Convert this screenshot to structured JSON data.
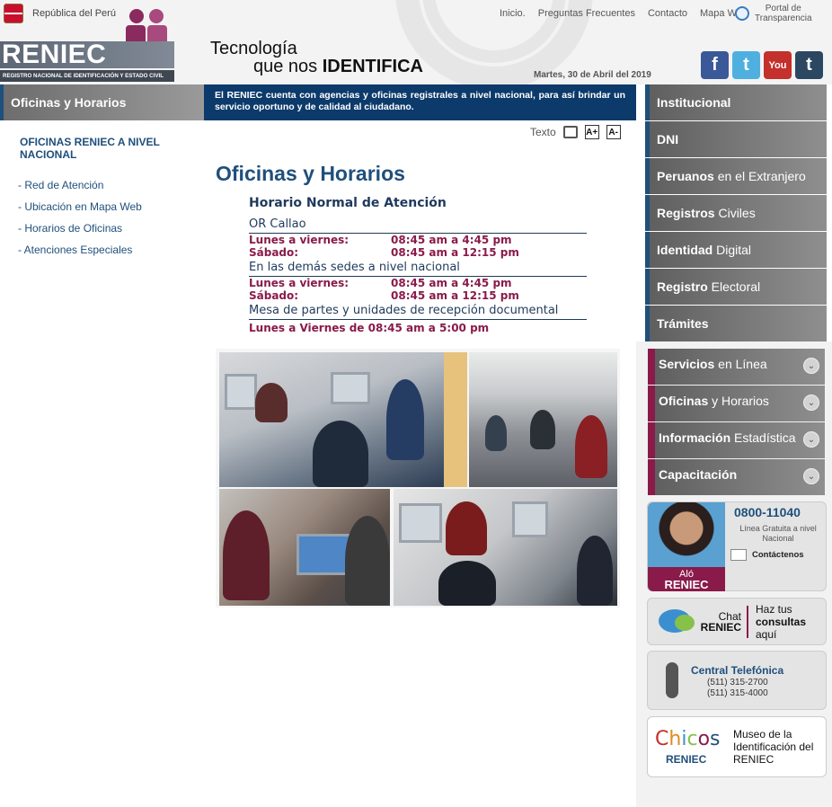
{
  "header": {
    "gov_label": "República del Perú",
    "logo_word": "RENIEC",
    "logo_sub": "REGISTRO NACIONAL DE IDENTIFICACIÓN Y ESTADO CIVIL",
    "slogan_l1": "Tecnología",
    "slogan_l2a": "que nos",
    "slogan_l2b": "IDENTIFICA",
    "topnav": [
      "Inicio.",
      "Preguntas Frecuentes",
      "Contacto",
      "Mapa Web"
    ],
    "transparency_l1": "Portal de",
    "transparency_l2": "Transparencia",
    "date": "Martes, 30 de Abril del 2019",
    "social": [
      {
        "name": "facebook-icon",
        "glyph": "f",
        "color": "#3b5998"
      },
      {
        "name": "twitter-icon",
        "glyph": "t",
        "color": "#4fb0e0"
      },
      {
        "name": "youtube-icon",
        "glyph": "You",
        "color": "#c4302b"
      },
      {
        "name": "tumblr-icon",
        "glyph": "t",
        "color": "#2c4762"
      }
    ]
  },
  "left": {
    "title": "Oficinas y Horarios",
    "section": "OFICINAS RENIEC A NIVEL NACIONAL",
    "links": [
      "- Red de Atención",
      "- Ubicación en Mapa Web",
      "- Horarios de Oficinas",
      "- Atenciones Especiales"
    ]
  },
  "main": {
    "notice": "El RENIEC cuenta con agencias y oficinas registrales a nivel nacional, para así brindar un servicio oportuno y de calidad al ciudadano.",
    "text_label": "Texto",
    "font_up": "A+",
    "font_down": "A-",
    "title": "Oficinas y Horarios",
    "hours": {
      "heading": "Horario Normal de Atención",
      "loc1": "OR Callao",
      "loc1_rows": [
        {
          "day": "Lunes a viernes:",
          "time": "08:45 am a 4:45 pm"
        },
        {
          "day": "Sábado:",
          "time": "08:45 am a 12:15 pm"
        }
      ],
      "loc2": "En las demás sedes a nivel nacional",
      "loc2_rows": [
        {
          "day": "Lunes a viernes:",
          "time": "08:45 am a 4:45 pm"
        },
        {
          "day": "Sábado:",
          "time": "08:45 am a 12:15 pm"
        }
      ],
      "loc3": "Mesa de partes y unidades de recepción documental",
      "loc3_note": "Lunes a Viernes de 08:45 am a 5:00 pm"
    }
  },
  "right": {
    "nav": [
      {
        "bold": "Institucional",
        "rest": ""
      },
      {
        "bold": "DNI",
        "rest": ""
      },
      {
        "bold": "Peruanos",
        "rest": " en el Extranjero"
      },
      {
        "bold": "Registros",
        "rest": " Civiles"
      },
      {
        "bold": "Identidad",
        "rest": " Digital"
      },
      {
        "bold": "Registro",
        "rest": " Electoral"
      },
      {
        "bold": "Trámites",
        "rest": ""
      }
    ],
    "nav2": [
      {
        "bold": "Servicios",
        "rest": " en Línea"
      },
      {
        "bold": "Oficinas",
        "rest": " y Horarios"
      },
      {
        "bold": "Información",
        "rest": " Estadística"
      },
      {
        "bold": "Capacitación",
        "rest": ""
      }
    ],
    "alo": {
      "brand_l1": "Aló",
      "brand_l2": "RENIEC",
      "phone": "0800-11040",
      "free_line": "Línea Gratuita a nivel Nacional",
      "contact": "Contáctenos"
    },
    "chat": {
      "l1": "Chat",
      "l2": "RENIEC",
      "t1": "Haz tus",
      "t2": "consultas",
      "t3": "aquí"
    },
    "central": {
      "title": "Central Telefónica",
      "n1": "(511) 315-2700",
      "n2": "(511) 315-4000"
    },
    "chicos": {
      "word": "Chicos",
      "sub": "RENIEC",
      "text": "Museo de la Identificación del RENIEC"
    }
  }
}
